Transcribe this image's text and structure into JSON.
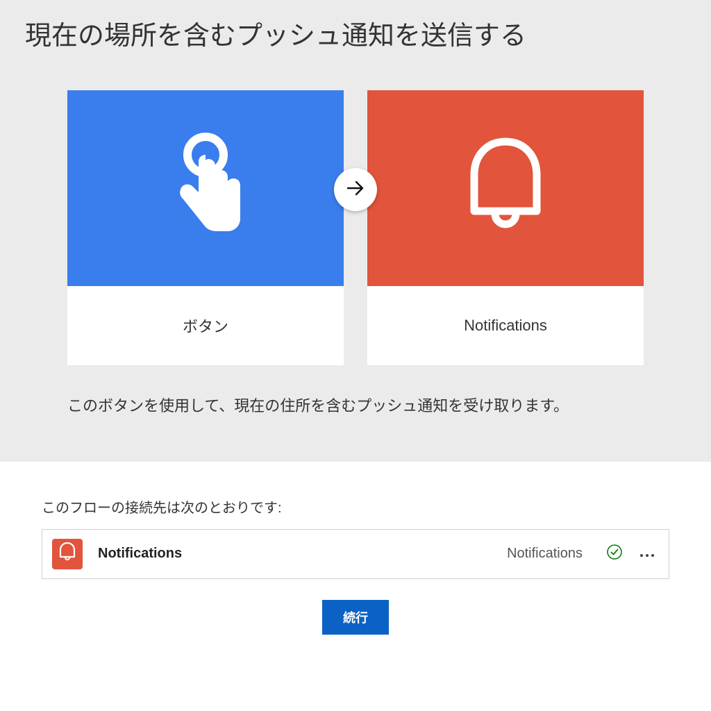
{
  "title": "現在の場所を含むプッシュ通知を送信する",
  "cards": {
    "left_label": "ボタン",
    "right_label": "Notifications"
  },
  "description": "このボタンを使用して、現在の住所を含むプッシュ通知を受け取ります。",
  "connections": {
    "heading": "このフローの接続先は次のとおりです:",
    "items": [
      {
        "name": "Notifications",
        "service": "Notifications"
      }
    ]
  },
  "continue_label": "続行",
  "colors": {
    "blue": "#3A7DED",
    "orange": "#E2543B",
    "primary_button": "#0b62c4"
  }
}
